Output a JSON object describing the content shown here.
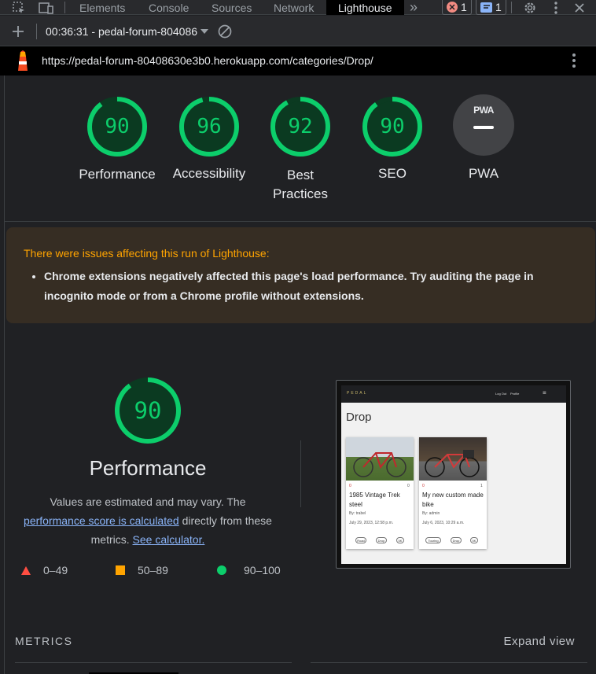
{
  "devtools": {
    "tabs": [
      "Elements",
      "Console",
      "Sources",
      "Network",
      "Lighthouse"
    ],
    "active_tab": "Lighthouse",
    "errors_count": "1",
    "messages_count": "1",
    "report_selector": "00:36:31 - pedal-forum-804086",
    "url": "https://pedal-forum-80408630e3b0.herokuapp.com/categories/Drop/"
  },
  "scores": [
    {
      "label": "Performance",
      "score": 90
    },
    {
      "label": "Accessibility",
      "score": 96
    },
    {
      "label": "Best Practices",
      "label_line1": "Best",
      "label_line2": "Practices",
      "score": 92
    },
    {
      "label": "SEO",
      "score": 90
    },
    {
      "label": "PWA",
      "badge": "PWA"
    }
  ],
  "warning": {
    "title": "There were issues affecting this run of Lighthouse:",
    "item": "Chrome extensions negatively affected this page's load performance. Try auditing the page in incognito mode or from a Chrome profile without extensions."
  },
  "performance": {
    "score": "90",
    "title": "Performance",
    "desc_1": "Values are estimated and may vary. The",
    "link_1": "performance score is calculated",
    "desc_2": "directly from these metrics.",
    "link_2": "See calculator."
  },
  "legend": [
    {
      "range": "0–49",
      "color": "#ff4e42"
    },
    {
      "range": "50–89",
      "color": "#ffa400"
    },
    {
      "range": "90–100",
      "color": "#0cce6b"
    }
  ],
  "metrics_label": "METRICS",
  "expand_label": "Expand view",
  "thumbnail": {
    "brand": "PEDAL",
    "nav_links": [
      "Log Out",
      "Profile"
    ],
    "heading": "Drop",
    "cards": [
      {
        "title": "1985 Vintage Trek steel",
        "author": "By: trabel",
        "date": "July 29, 2023, 12:58 p.m.",
        "likes": "0",
        "comments": "0",
        "tags": [
          "Road",
          "Drop",
          "5K"
        ]
      },
      {
        "title": "My new custom made bike",
        "author": "By: admin",
        "date": "July 6, 2023, 10:29 a.m.",
        "likes": "0",
        "comments": "1",
        "tags": [
          "Touring",
          "Drop",
          "5K"
        ]
      }
    ]
  },
  "colors": {
    "pass": "#0cce6b",
    "pass_bg": "#0b3a21",
    "bg": "#202124"
  }
}
